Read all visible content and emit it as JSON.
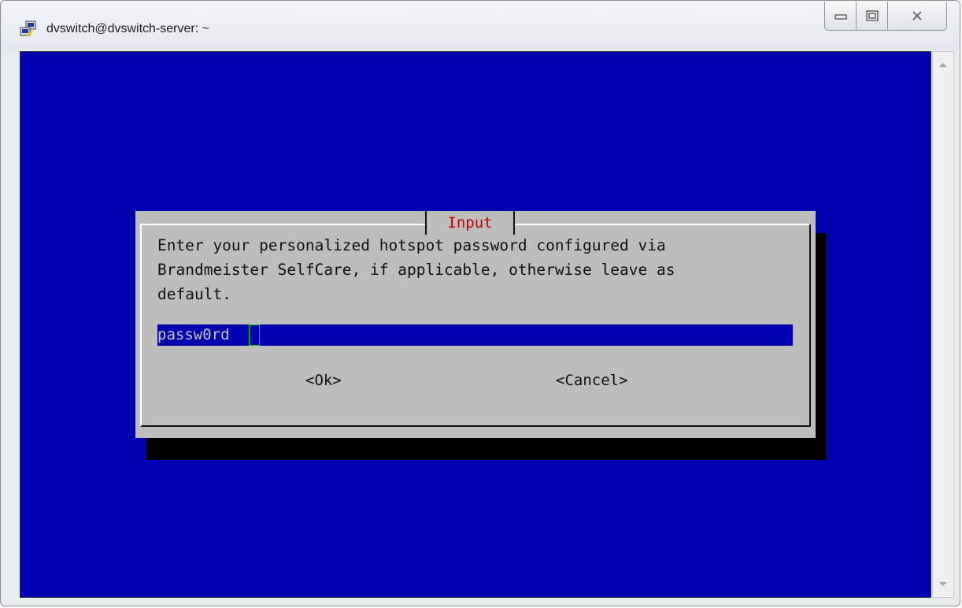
{
  "window": {
    "title": "dvswitch@dvswitch-server: ~"
  },
  "dialog": {
    "title": "Input",
    "message_lines": [
      "Enter your personalized hotspot password configured via",
      "Brandmeister SelfCare, if applicable, otherwise leave as",
      "default."
    ],
    "input_value": "passw0rd",
    "ok_label": "<Ok>",
    "cancel_label": "<Cancel>"
  },
  "colors": {
    "terminal_bg": "#0000b0",
    "dialog_bg": "#bdbdbd",
    "dialog_title": "#c00000",
    "cursor": "#00d000"
  },
  "icons": {
    "app": "putty-icon",
    "minimize": "minimize-icon",
    "maximize": "maximize-icon",
    "close": "close-icon"
  }
}
